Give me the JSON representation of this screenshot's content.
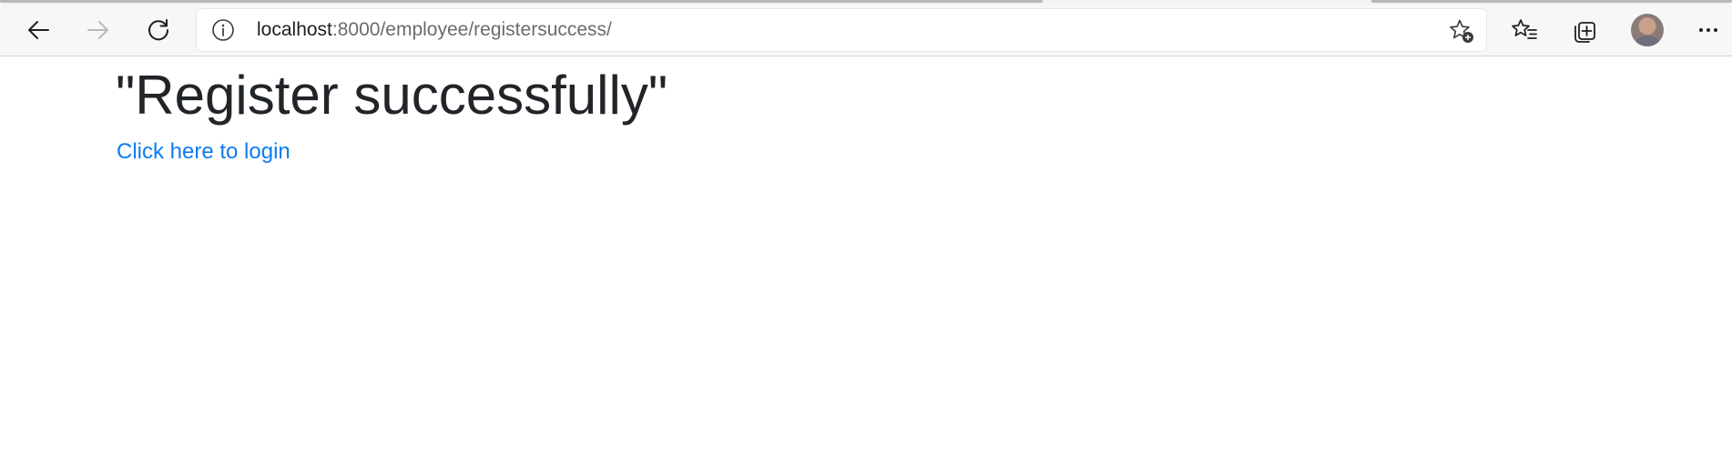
{
  "browser": {
    "address_bar": {
      "host": "localhost",
      "path": ":8000/employee/registersuccess/"
    },
    "icons": {
      "back": "back-arrow-icon",
      "forward": "forward-arrow-icon",
      "refresh": "refresh-icon",
      "site_info": "info-icon",
      "add_favorite": "star-add-icon",
      "favorites": "favorites-icon",
      "collections": "collections-icon",
      "profile": "avatar",
      "menu": "more-icon"
    },
    "forward_enabled": false
  },
  "page": {
    "heading": "\"Register successfully\"",
    "login_link": "Click here to login"
  },
  "colors": {
    "link": "#0d7bf2",
    "heading": "#212529",
    "toolbar_bg": "#f7f7f7"
  }
}
